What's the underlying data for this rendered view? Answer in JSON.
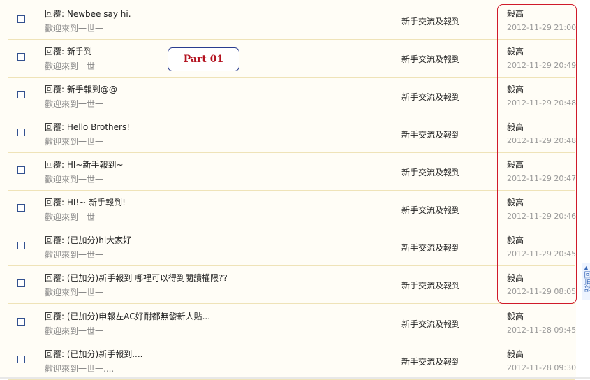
{
  "label_part": "Part 01",
  "back_to_top": {
    "arrow": "▲",
    "text": "回頂部"
  },
  "posts": [
    {
      "title": "回覆:  Newbee say hi.",
      "preview": "歡迎來到一世一",
      "forum": "新手交流及報到",
      "author": "毅高",
      "time": "2012-11-29 21:00"
    },
    {
      "title": "回覆:  新手到",
      "preview": "歡迎來到一世一",
      "forum": "新手交流及報到",
      "author": "毅高",
      "time": "2012-11-29 20:49"
    },
    {
      "title": "回覆:  新手報到@@",
      "preview": "歡迎來到一世一",
      "forum": "新手交流及報到",
      "author": "毅高",
      "time": "2012-11-29 20:48"
    },
    {
      "title": "回覆:  Hello Brothers!",
      "preview": "歡迎來到一世一",
      "forum": "新手交流及報到",
      "author": "毅高",
      "time": "2012-11-29 20:48"
    },
    {
      "title": "回覆:  HI~新手報到~",
      "preview": "歡迎來到一世一",
      "forum": "新手交流及報到",
      "author": "毅高",
      "time": "2012-11-29 20:47"
    },
    {
      "title": "回覆:  HI!~ 新手報到!",
      "preview": "歡迎來到一世一",
      "forum": "新手交流及報到",
      "author": "毅高",
      "time": "2012-11-29 20:46"
    },
    {
      "title": "回覆:  (已加分)hi大家好",
      "preview": "歡迎來到一世一",
      "forum": "新手交流及報到",
      "author": "毅高",
      "time": "2012-11-29 20:45"
    },
    {
      "title": "回覆:  (已加分)新手報到 哪裡可以得到閱讀權限??",
      "preview": "歡迎來到一世一",
      "forum": "新手交流及報到",
      "author": "毅高",
      "time": "2012-11-29 08:05"
    },
    {
      "title": "回覆:  (已加分)申報左AC好耐都無發新人貼...",
      "preview": "歡迎來到一世一",
      "forum": "新手交流及報到",
      "author": "毅高",
      "time": "2012-11-28 09:45"
    },
    {
      "title": "回覆:  (已加分)新手報到....",
      "preview": "歡迎來到一世一....",
      "forum": "新手交流及報到",
      "author": "毅高",
      "time": "2012-11-28 09:30"
    }
  ]
}
